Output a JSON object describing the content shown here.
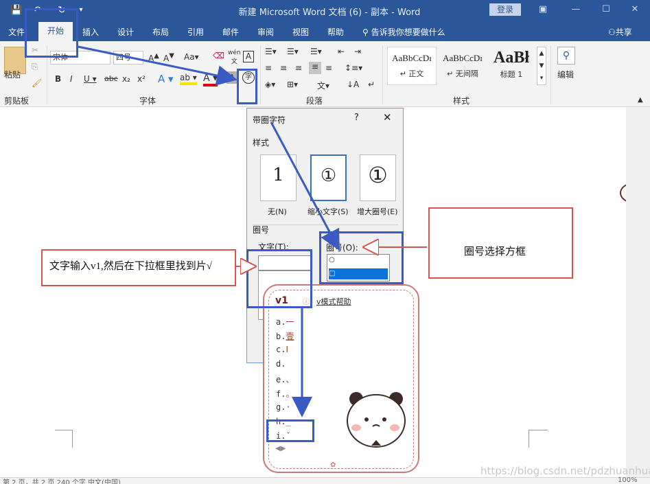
{
  "titlebar": {
    "title": "新建 Microsoft Word 文档 (6) - 副本  -  Word",
    "login": "登录"
  },
  "tabs": [
    {
      "label": "文件"
    },
    {
      "label": "开始"
    },
    {
      "label": "插入"
    },
    {
      "label": "设计"
    },
    {
      "label": "布局"
    },
    {
      "label": "引用"
    },
    {
      "label": "邮件"
    },
    {
      "label": "审阅"
    },
    {
      "label": "视图"
    },
    {
      "label": "帮助"
    },
    {
      "label": "告诉我你想要做什么"
    }
  ],
  "share_label": "共享",
  "ribbon": {
    "paste_label": "粘贴",
    "clipboard_label": "剪贴板",
    "font_name": "宋体",
    "font_size": "四号",
    "font_label": "字体",
    "paragraph_label": "段落",
    "styles_label": "样式",
    "edit_label": "编辑",
    "enclose_char": "字",
    "styles": [
      {
        "sample": "AaBbCcDı",
        "name": "↵ 正文"
      },
      {
        "sample": "AaBbCcDı",
        "name": "↵ 无间隔"
      },
      {
        "sample": "AaBł",
        "name": "标题 1"
      }
    ]
  },
  "dialog": {
    "title": "带圈字符",
    "help": "?",
    "close": "✕",
    "style_label": "样式",
    "options": [
      {
        "char": "1",
        "label": "无(N)"
      },
      {
        "char": "①",
        "label": "缩小文字(S)"
      },
      {
        "char": "①",
        "label": "增大圈号(E)"
      }
    ],
    "ring_section": "圈号",
    "text_label": "文字(T):",
    "ring_label": "圈号(O):",
    "ring_options": [
      "○",
      "□"
    ]
  },
  "ime": {
    "input": "v1",
    "help": "v模式帮助",
    "candidates": [
      {
        "key": "a.",
        "value": "一"
      },
      {
        "key": "b.",
        "value": "壹"
      },
      {
        "key": "c.",
        "value": "Ⅰ"
      },
      {
        "key": "d.",
        "value": ""
      },
      {
        "key": "e.",
        "value": "、"
      },
      {
        "key": "f.",
        "value": "。"
      },
      {
        "key": "g.",
        "value": "·"
      },
      {
        "key": "h.",
        "value": "_"
      },
      {
        "key": "i.",
        "value": "ˇ"
      }
    ]
  },
  "annotations": {
    "left": "文字输入v1,然后在下拉框里找到片√",
    "right": "圈号选择方框"
  },
  "status": {
    "left": "第 2 页，共 2 页    240 个字    中文(中国)",
    "zoom": "100%"
  },
  "watermark": "https://blog.csdn.net/pdzhuanhua"
}
